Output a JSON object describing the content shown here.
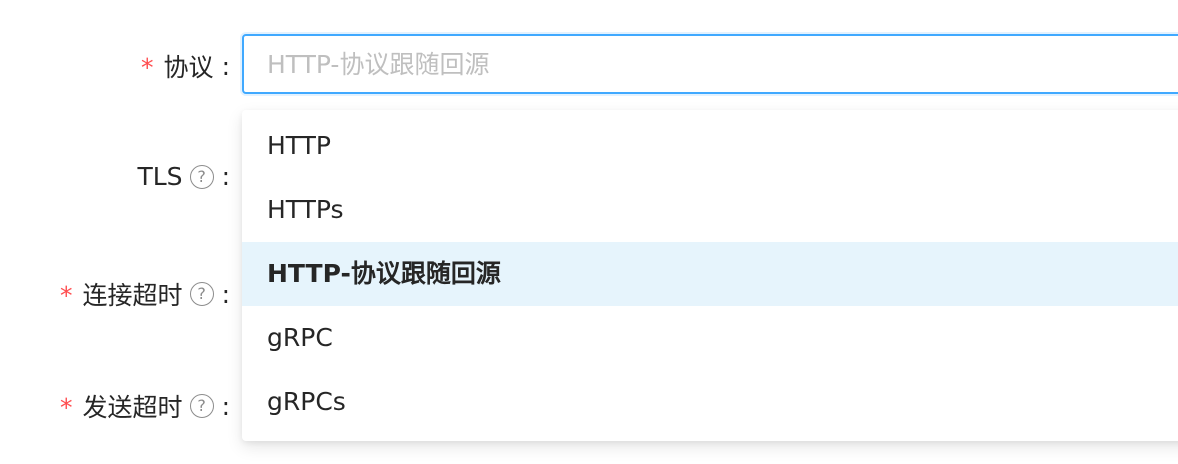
{
  "form": {
    "fields": [
      {
        "label": "协议",
        "required": true,
        "help": false
      },
      {
        "label": "TLS",
        "required": false,
        "help": true
      },
      {
        "label": "连接超时",
        "required": true,
        "help": true
      },
      {
        "label": "发送超时",
        "required": true,
        "help": true
      }
    ],
    "required_mark": "*",
    "colon": ":",
    "help_icon_glyph": "?"
  },
  "protocol_select": {
    "placeholder": "HTTP-协议跟随回源",
    "options": [
      "HTTP",
      "HTTPs",
      "HTTP-协议跟随回源",
      "gRPC",
      "gRPCs"
    ],
    "selected_index": 2
  },
  "colors": {
    "required": "#ff4d4f",
    "focus_border": "#40a9ff",
    "option_selected_bg": "#e6f4fc",
    "placeholder": "#bfbfbf"
  }
}
